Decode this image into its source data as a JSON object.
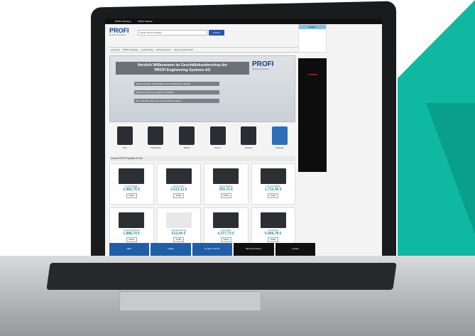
{
  "scene": {
    "accent_green": "#0fb8a0",
    "laptop_color": "#1a1b1d"
  },
  "website": {
    "top_links": [
      "PROFI Webshop",
      "PROFI Website"
    ],
    "logo_text": "PROFI",
    "logo_sub": "Engineering Systems",
    "search_placeholder": "Finden Sie Ihr Produkt!",
    "search_button": "Suchen",
    "nav": [
      "Startseite",
      "PROFI Kataloge",
      "Zusatzkonfig",
      "Zahlungsweisen",
      "Rechnungsanschrift"
    ],
    "banner": {
      "title_line1": "Herzlich Willkommen im Geschäftskundenshop der",
      "title_line2": "PROFI Engineering Systems AG",
      "bullets": [
        "Sicheres Kaufen und Bezahlen beim Zertifizierten Händler",
        "Schnelle Lieferung verfügbarer Produkte",
        "Über 100.000 Artikel und mehr als 80 Herstellern"
      ],
      "logo_text": "PROFI",
      "logo_sub": "Engineering Systems"
    },
    "categories": [
      "PCs",
      "Notebooks",
      "Tablets",
      "Server",
      "Drucker",
      "Software"
    ],
    "section_title": "Unsere PROFI Topseller für Sie",
    "products": [
      {
        "name": "Lenovo Storage",
        "price": "2.962,75 €",
        "button": "Details"
      },
      {
        "name": "Lenovo System",
        "price": "3.513,11 €",
        "button": "Details"
      },
      {
        "name": "Kyocera Drucker",
        "price": "269,73 €",
        "button": "Details"
      },
      {
        "name": "Lenovo ThinkPad",
        "price": "1.712,46 €",
        "button": "Details"
      },
      {
        "name": "Lenovo ThinkServer",
        "price": "1.888,74 €",
        "button": "Details"
      },
      {
        "name": "Cisco Access Point",
        "price": "613,44 €",
        "button": "Details"
      },
      {
        "name": "Cisco Switch",
        "price": "4.377,73 €",
        "button": "Details"
      },
      {
        "name": "Cisco Router",
        "price": "6.906,78 €",
        "button": "Details"
      }
    ],
    "side_box_title": "Fragen?",
    "dark_ad_text": "Lenovo",
    "partners": [
      "DELL",
      "Fujitsu",
      "hp Silver Partner",
      "Microsoft Partner",
      "vmware"
    ]
  }
}
